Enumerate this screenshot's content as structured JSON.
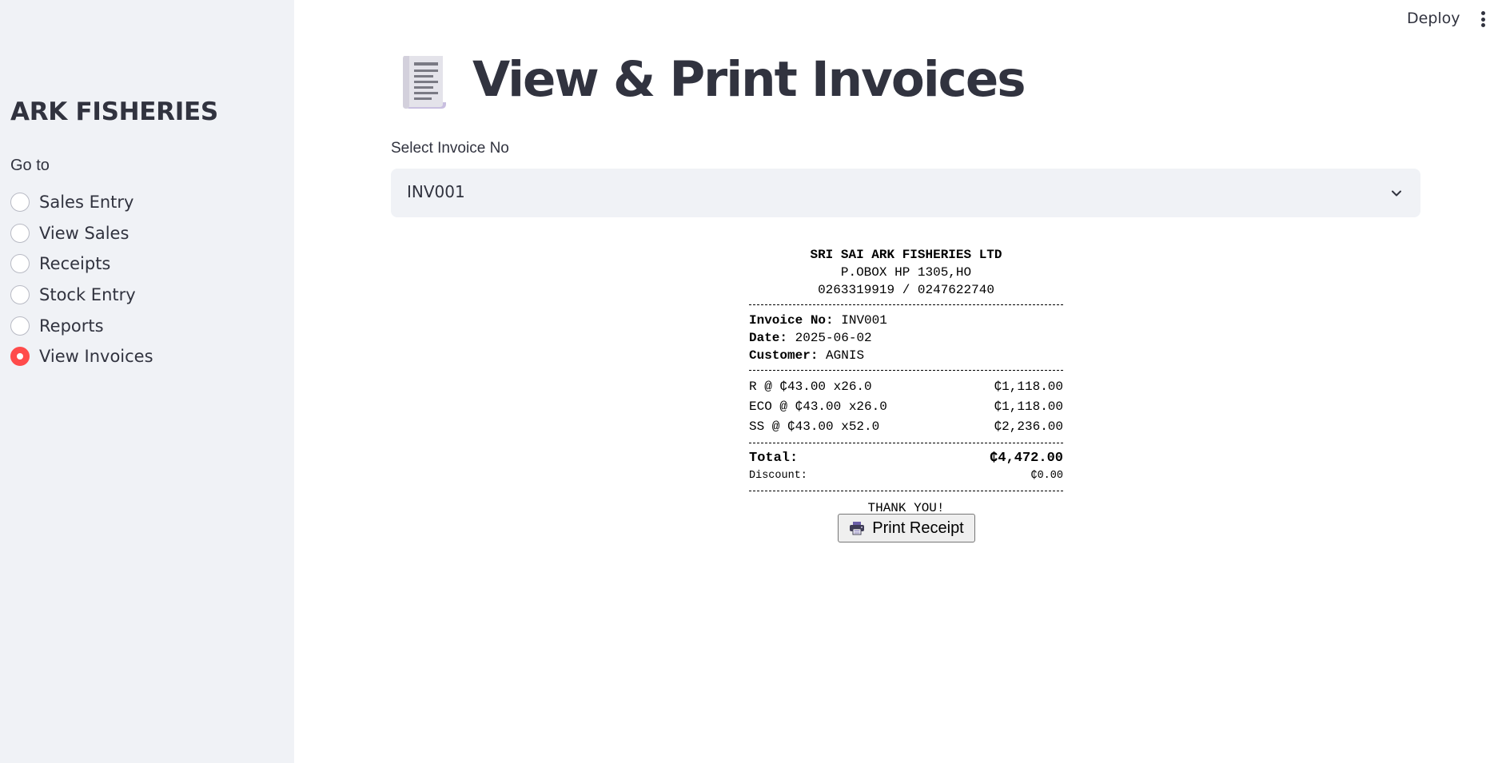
{
  "sidebar": {
    "title": "ARK FISHERIES",
    "goto_label": "Go to",
    "items": [
      {
        "label": "Sales Entry",
        "selected": false
      },
      {
        "label": "View Sales",
        "selected": false
      },
      {
        "label": "Receipts",
        "selected": false
      },
      {
        "label": "Stock Entry",
        "selected": false
      },
      {
        "label": "Reports",
        "selected": false
      },
      {
        "label": "View Invoices",
        "selected": true
      }
    ]
  },
  "header": {
    "deploy_label": "Deploy",
    "menu_icon": "kebab-menu-icon"
  },
  "main": {
    "title": "View & Print Invoices",
    "title_icon": "receipt-icon",
    "select_label": "Select Invoice No",
    "select_value": "INV001"
  },
  "receipt": {
    "company": "SRI SAI ARK FISHERIES LTD",
    "address": "P.OBOX HP 1305,HO",
    "phones": "0263319919 / 0247622740",
    "invoice_label": "Invoice No:",
    "invoice_no": "INV001",
    "date_label": "Date:",
    "date": "2025-06-02",
    "customer_label": "Customer:",
    "customer": "AGNIS",
    "items": [
      {
        "desc": "R @ ₵43.00 x26.0",
        "amount": "₵1,118.00"
      },
      {
        "desc": "ECO @ ₵43.00 x26.0",
        "amount": "₵1,118.00"
      },
      {
        "desc": "SS @ ₵43.00 x52.0",
        "amount": "₵2,236.00"
      }
    ],
    "total_label": "Total:",
    "total": "₵4,472.00",
    "discount_label": "Discount:",
    "discount": "₵0.00",
    "thank_you": "THANK YOU!",
    "print_label": "Print Receipt",
    "print_icon": "printer-icon"
  },
  "colors": {
    "sidebar_bg": "#f0f2f6",
    "accent": "#ff4b4b",
    "text": "#31333f"
  }
}
